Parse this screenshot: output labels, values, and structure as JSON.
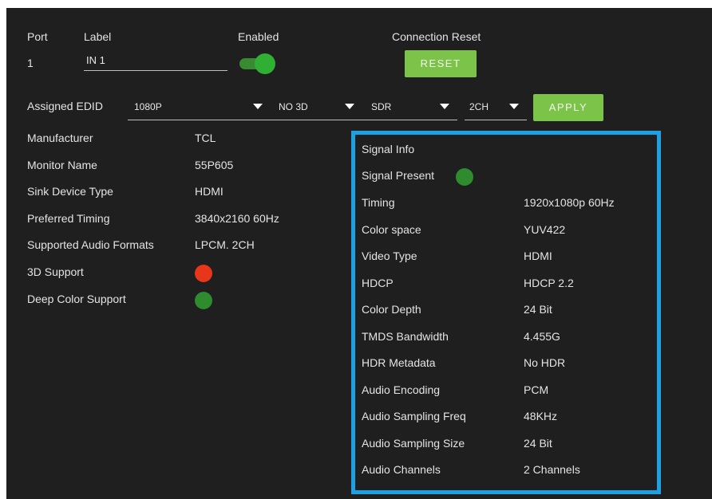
{
  "header": {
    "port_label": "Port",
    "port_value": "1",
    "label_label": "Label",
    "label_value": "IN 1",
    "enabled_label": "Enabled",
    "connection_reset_label": "Connection Reset",
    "reset_button": "RESET"
  },
  "edid": {
    "assigned_label": "Assigned EDID",
    "resolution": "1080P",
    "mode_3d": "NO 3D",
    "dynamic_range": "SDR",
    "audio": "2CH",
    "apply_button": "APPLY"
  },
  "sink": {
    "rows": [
      {
        "label": "Manufacturer",
        "value": "TCL"
      },
      {
        "label": "Monitor Name",
        "value": "55P605"
      },
      {
        "label": "Sink Device Type",
        "value": "HDMI"
      },
      {
        "label": "Preferred Timing",
        "value": "3840x2160 60Hz"
      },
      {
        "label": "Supported Audio Formats",
        "value": "LPCM. 2CH"
      }
    ],
    "support_3d_label": "3D Support",
    "deep_color_label": "Deep Color Support"
  },
  "signal": {
    "title": "Signal Info",
    "present_label": "Signal Present",
    "rows": [
      {
        "label": "Timing",
        "value": "1920x1080p 60Hz"
      },
      {
        "label": "Color space",
        "value": "YUV422"
      },
      {
        "label": "Video Type",
        "value": "HDMI"
      },
      {
        "label": "HDCP",
        "value": "HDCP 2.2"
      },
      {
        "label": "Color Depth",
        "value": "24 Bit"
      },
      {
        "label": "TMDS Bandwidth",
        "value": "4.455G"
      },
      {
        "label": "HDR Metadata",
        "value": "No HDR"
      },
      {
        "label": "Audio Encoding",
        "value": "PCM"
      },
      {
        "label": "Audio Sampling Freq",
        "value": "48KHz"
      },
      {
        "label": "Audio Sampling Size",
        "value": "24 Bit"
      },
      {
        "label": "Audio Channels",
        "value": "2 Channels"
      }
    ]
  },
  "colors": {
    "status_green": "#2e8b2e",
    "status_red": "#e8361a",
    "accent_blue": "#1da1e2",
    "button_green": "#7cc34a"
  }
}
